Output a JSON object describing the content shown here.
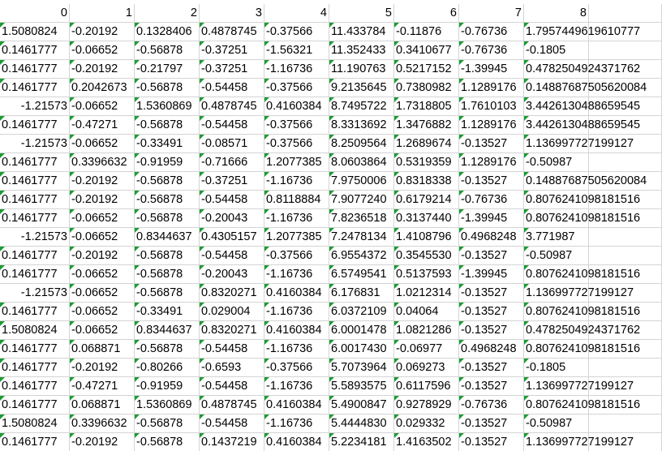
{
  "sheet": {
    "headers": [
      "0",
      "1",
      "2",
      "3",
      "4",
      "5",
      "6",
      "7",
      "8"
    ],
    "rows": [
      [
        "1.5080824",
        "-0.20192",
        "0.1328406",
        "0.4878745",
        "-0.37566",
        "11.433784",
        "-0.11876",
        "-0.76736",
        "1.7957449619610777"
      ],
      [
        "0.1461777",
        "-0.06652",
        "-0.56878",
        "-0.37251",
        "-1.56321",
        "11.352433",
        "0.3410677",
        "-0.76736",
        "-0.1805"
      ],
      [
        "0.1461777",
        "-0.20192",
        "-0.21797",
        "-0.37251",
        "-1.16736",
        "11.190763",
        "0.5217152",
        "-1.39945",
        "0.4782504924371762"
      ],
      [
        "0.1461777",
        "0.2042673",
        "-0.56878",
        "-0.54458",
        "-0.37566",
        "9.2135645",
        "0.7380982",
        "1.1289176",
        "0.14887687505620084"
      ],
      [
        "-1.21573",
        "-0.06652",
        "1.5360869",
        "0.4878745",
        "0.4160384",
        "8.7495722",
        "1.7318805",
        "1.7610103",
        "3.4426130488659545"
      ],
      [
        "0.1461777",
        "-0.47271",
        "-0.56878",
        "-0.54458",
        "-0.37566",
        "8.3313692",
        "1.3476882",
        "1.1289176",
        "3.4426130488659545"
      ],
      [
        "-1.21573",
        "-0.06652",
        "-0.33491",
        "-0.08571",
        "-0.37566",
        "8.2509564",
        "1.2689674",
        "-0.13527",
        "1.136997727199127"
      ],
      [
        "0.1461777",
        "0.3396632",
        "-0.91959",
        "-0.71666",
        "1.2077385",
        "8.0603864",
        "0.5319359",
        "1.1289176",
        "-0.50987"
      ],
      [
        "0.1461777",
        "-0.20192",
        "-0.56878",
        "-0.37251",
        "-1.16736",
        "7.9750006",
        "0.8318338",
        "-0.13527",
        "0.14887687505620084"
      ],
      [
        "0.1461777",
        "-0.20192",
        "-0.56878",
        "-0.54458",
        "0.8118884",
        "7.9077240",
        "0.6179214",
        "-0.76736",
        "0.8076241098181516"
      ],
      [
        "0.1461777",
        "-0.06652",
        "-0.56878",
        "-0.20043",
        "-1.16736",
        "7.8236518",
        "0.3137440",
        "-1.39945",
        "0.8076241098181516"
      ],
      [
        "-1.21573",
        "-0.06652",
        "0.8344637",
        "0.4305157",
        "1.2077385",
        "7.2478134",
        "1.4108796",
        "0.4968248",
        "3.771987"
      ],
      [
        "0.1461777",
        "-0.20192",
        "-0.56878",
        "-0.54458",
        "-0.37566",
        "6.9554372",
        "0.3545530",
        "-0.13527",
        "-0.50987"
      ],
      [
        "0.1461777",
        "-0.06652",
        "-0.56878",
        "-0.20043",
        "-1.16736",
        "6.5749541",
        "0.5137593",
        "-1.39945",
        "0.8076241098181516"
      ],
      [
        "-1.21573",
        "-0.06652",
        "-0.56878",
        "0.8320271",
        "0.4160384",
        "6.176831",
        "1.0212314",
        "-0.13527",
        "1.136997727199127"
      ],
      [
        "0.1461777",
        "-0.06652",
        "-0.33491",
        "0.029004",
        "-1.16736",
        "6.0372109",
        "0.04064",
        "-0.13527",
        "0.8076241098181516"
      ],
      [
        "1.5080824",
        "-0.06652",
        "0.8344637",
        "0.8320271",
        "0.4160384",
        "6.0001478",
        "1.0821286",
        "-0.13527",
        "0.4782504924371762"
      ],
      [
        "0.1461777",
        "0.068871",
        "-0.56878",
        "-0.54458",
        "-1.16736",
        "6.0017430",
        "-0.06977",
        "0.4968248",
        "0.8076241098181516"
      ],
      [
        "0.1461777",
        "-0.20192",
        "-0.80266",
        "-0.6593",
        "-0.37566",
        "5.7073964",
        "0.069273",
        "-0.13527",
        "-0.1805"
      ],
      [
        "0.1461777",
        "-0.47271",
        "-0.91959",
        "-0.54458",
        "-1.16736",
        "5.5893575",
        "0.6117596",
        "-0.13527",
        "1.136997727199127"
      ],
      [
        "0.1461777",
        "0.068871",
        "1.5360869",
        "0.4878745",
        "0.4160384",
        "5.4900847",
        "0.9278929",
        "-0.76736",
        "0.8076241098181516"
      ],
      [
        "1.5080824",
        "0.3396632",
        "-0.56878",
        "-0.54458",
        "-1.16736",
        "5.4444830",
        "0.029332",
        "-0.13527",
        "-0.50987"
      ],
      [
        "0.1461777",
        "-0.20192",
        "-0.56878",
        "0.1437219",
        "0.4160384",
        "5.2234181",
        "1.4163502",
        "-0.13527",
        "1.136997727199127"
      ]
    ],
    "text_marker_color": "#1a9c33"
  }
}
